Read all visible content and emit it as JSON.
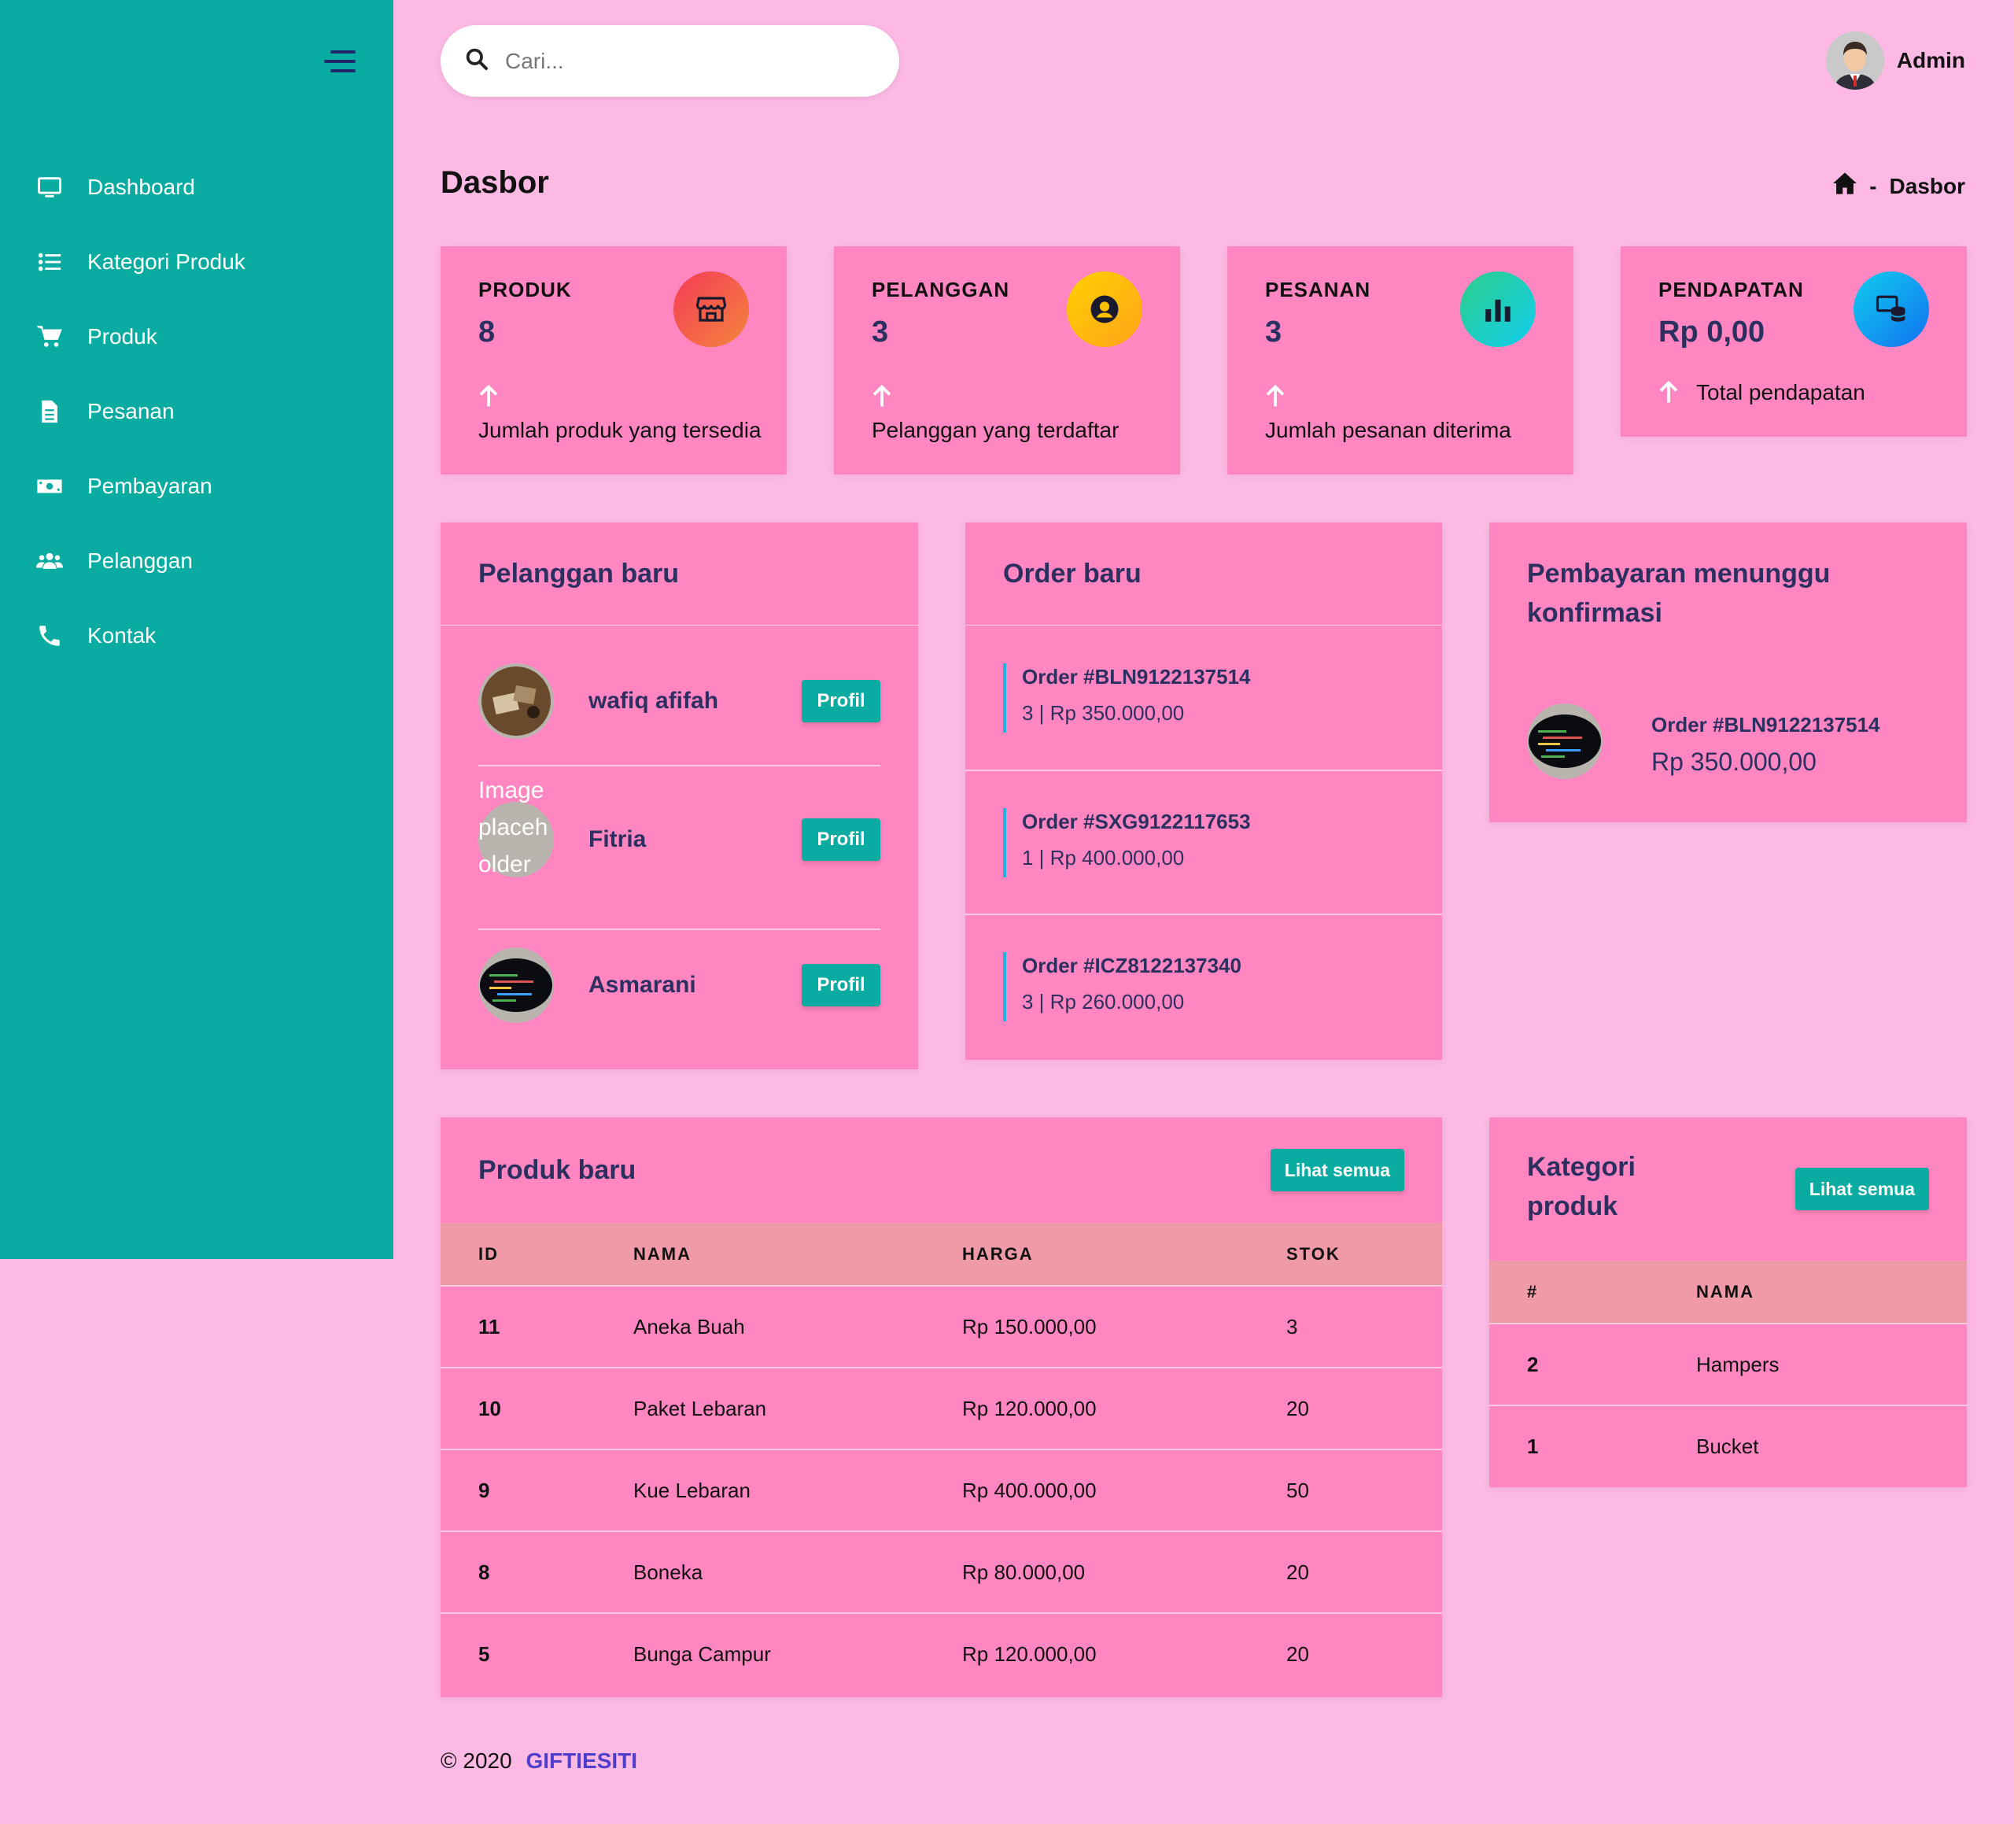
{
  "sidebar": {
    "items": [
      {
        "label": "Dashboard",
        "icon": "monitor-icon"
      },
      {
        "label": "Kategori Produk",
        "icon": "list-icon"
      },
      {
        "label": "Produk",
        "icon": "cart-icon"
      },
      {
        "label": "Pesanan",
        "icon": "file-icon"
      },
      {
        "label": "Pembayaran",
        "icon": "money-icon"
      },
      {
        "label": "Pelanggan",
        "icon": "users-icon"
      },
      {
        "label": "Kontak",
        "icon": "phone-icon"
      }
    ]
  },
  "header": {
    "search_placeholder": "Cari...",
    "user_name": "Admin"
  },
  "page": {
    "title": "Dasbor",
    "breadcrumb_sep": "-",
    "breadcrumb_current": "Dasbor"
  },
  "stats": [
    {
      "label": "PRODUK",
      "value": "8",
      "desc": "Jumlah produk yang tersedia",
      "icon": "store-icon",
      "color": "#f53b57"
    },
    {
      "label": "PELANGGAN",
      "value": "3",
      "desc": "Pelanggan yang terdaftar",
      "icon": "user-circle-icon",
      "color": "#ffb400"
    },
    {
      "label": "PESANAN",
      "value": "3",
      "desc": "Jumlah pesanan diterima",
      "icon": "bar-chart-icon",
      "color": "#1ed5c3"
    },
    {
      "label": "PENDAPATAN",
      "value": "Rp 0,00",
      "desc": "Total pendapatan",
      "icon": "coins-icon",
      "color": "#1a8cff"
    }
  ],
  "new_customers": {
    "title": "Pelanggan baru",
    "button_label": "Profil",
    "items": [
      {
        "name": "wafiq afifah"
      },
      {
        "name": "Fitria",
        "alt": "Image placeholder"
      },
      {
        "name": "Asmarani"
      }
    ]
  },
  "new_orders": {
    "title": "Order baru",
    "items": [
      {
        "id": "Order #BLN9122137514",
        "meta": "3 | Rp 350.000,00"
      },
      {
        "id": "Order #SXG9122117653",
        "meta": "1 | Rp 400.000,00"
      },
      {
        "id": "Order #ICZ8122137340",
        "meta": "3 | Rp 260.000,00"
      }
    ]
  },
  "pending_payments": {
    "title_line1": "Pembayaran menunggu",
    "title_line2": "konfirmasi",
    "items": [
      {
        "id": "Order #BLN9122137514",
        "amount": "Rp 350.000,00"
      }
    ]
  },
  "new_products": {
    "title": "Produk baru",
    "button_label": "Lihat semua",
    "columns": [
      "ID",
      "NAMA",
      "HARGA",
      "STOK"
    ],
    "rows": [
      [
        "11",
        "Aneka Buah",
        "Rp 150.000,00",
        "3"
      ],
      [
        "10",
        "Paket Lebaran",
        "Rp 120.000,00",
        "20"
      ],
      [
        "9",
        "Kue Lebaran",
        "Rp 400.000,00",
        "50"
      ],
      [
        "8",
        "Boneka",
        "Rp 80.000,00",
        "20"
      ],
      [
        "5",
        "Bunga Campur",
        "Rp 120.000,00",
        "20"
      ]
    ]
  },
  "categories": {
    "title_line1": "Kategori",
    "title_line2": "produk",
    "button_label": "Lihat semua",
    "columns": [
      "#",
      "NAMA"
    ],
    "rows": [
      [
        "2",
        "Hampers"
      ],
      [
        "1",
        "Bucket"
      ]
    ]
  },
  "footer": {
    "copyright": "© 2020",
    "brand": "GIFTIESITI"
  },
  "colors": {
    "sidebar": "#0aaba0",
    "background": "#fbb9e4",
    "card": "#ff86c0",
    "accent_text": "#2c3061",
    "brand_link": "#4f3dcc"
  }
}
